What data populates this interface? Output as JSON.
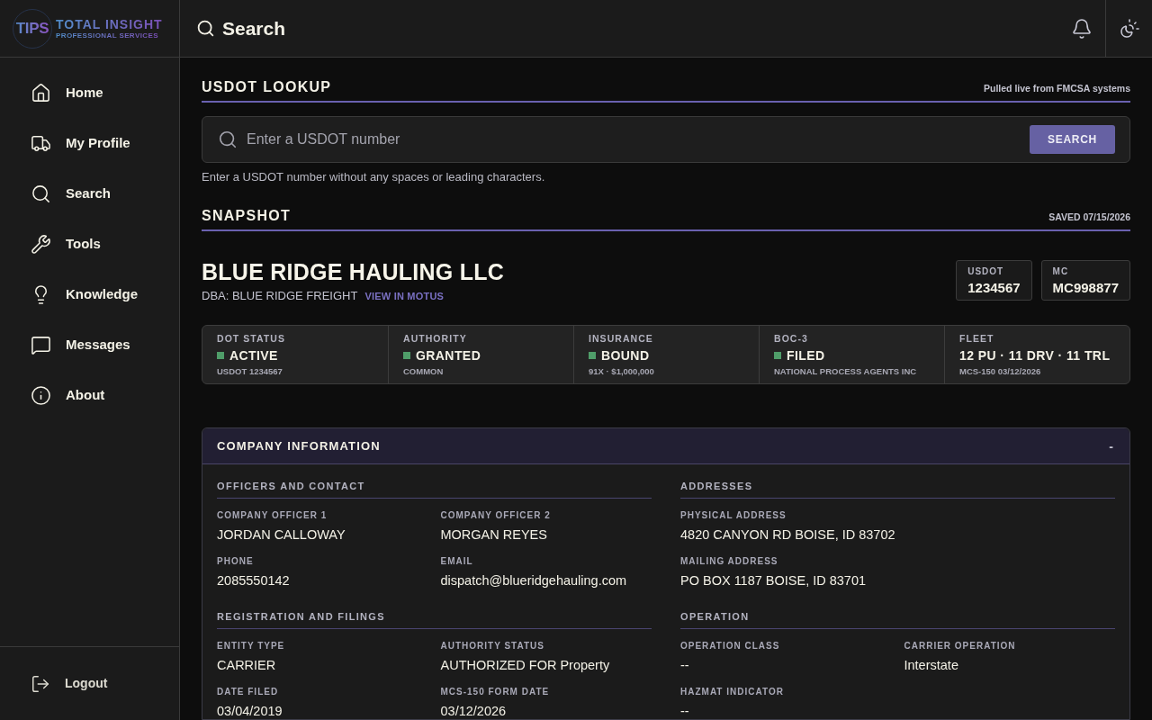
{
  "logo": {
    "mark": "TIPS",
    "title": "TOTAL INSIGHT",
    "subtitle": "PROFESSIONAL SERVICES"
  },
  "top_bar": {
    "search_label": "Search"
  },
  "sidebar": {
    "items": [
      {
        "label": "Home"
      },
      {
        "label": "My Profile"
      },
      {
        "label": "Search"
      },
      {
        "label": "Tools"
      },
      {
        "label": "Knowledge"
      },
      {
        "label": "Messages"
      },
      {
        "label": "About"
      }
    ],
    "logout": {
      "label": "Logout"
    }
  },
  "lookup": {
    "title": "USDOT LOOKUP",
    "note": "Pulled live from FMCSA systems",
    "placeholder": "Enter a USDOT number",
    "button": "SEARCH",
    "hint": "Enter a USDOT number without any spaces or leading characters."
  },
  "snapshot": {
    "title": "SNAPSHOT",
    "saved": "SAVED 07/15/2026",
    "company_name": "BLUE RIDGE HAULING LLC",
    "dba": "DBA: BLUE RIDGE FREIGHT",
    "link": "VIEW IN MOTUS",
    "ids": [
      {
        "label": "USDOT",
        "value": "1234567"
      },
      {
        "label": "MC",
        "value": "MC998877"
      }
    ],
    "statuses": [
      {
        "label": "DOT STATUS",
        "value": "ACTIVE",
        "detail": "USDOT 1234567",
        "color": "#4f9d69"
      },
      {
        "label": "AUTHORITY",
        "value": "GRANTED",
        "detail": "COMMON",
        "color": "#4f9d69"
      },
      {
        "label": "INSURANCE",
        "value": "BOUND",
        "detail": "91X · $1,000,000",
        "color": "#4f9d69"
      },
      {
        "label": "BOC-3",
        "value": "FILED",
        "detail": "NATIONAL PROCESS AGENTS INC",
        "color": "#4f9d69"
      },
      {
        "label": "FLEET",
        "value": "12 PU · 11 DRV · 11 TRL",
        "detail": "MCS-150 03/12/2026"
      }
    ]
  },
  "company_information": {
    "title": "COMPANY INFORMATION",
    "toggle": "-",
    "expanded": true,
    "sections": [
      {
        "title": "OFFICERS AND CONTACT",
        "kind": "grid",
        "fields": [
          {
            "label": "COMPANY OFFICER 1",
            "value": "JORDAN CALLOWAY"
          },
          {
            "label": "COMPANY OFFICER 2",
            "value": "MORGAN REYES"
          },
          {
            "label": "PHONE",
            "value": "2085550142"
          },
          {
            "label": "EMAIL",
            "value": "dispatch@blueridgehauling.com"
          }
        ]
      },
      {
        "title": "ADDRESSES",
        "kind": "stack",
        "fields": [
          {
            "label": "PHYSICAL ADDRESS",
            "value": "4820 CANYON RD BOISE, ID 83702"
          },
          {
            "label": "MAILING ADDRESS",
            "value": "PO BOX 1187 BOISE, ID 83701"
          }
        ]
      },
      {
        "title": "REGISTRATION AND FILINGS",
        "kind": "grid",
        "fields": [
          {
            "label": "ENTITY TYPE",
            "value": "CARRIER"
          },
          {
            "label": "AUTHORITY STATUS",
            "value": "AUTHORIZED FOR Property"
          },
          {
            "label": "DATE FILED",
            "value": "03/04/2019"
          },
          {
            "label": "MCS-150 FORM DATE",
            "value": "03/12/2026"
          }
        ]
      },
      {
        "title": "OPERATION",
        "kind": "grid",
        "fields": [
          {
            "label": "OPERATION CLASS",
            "value": "--"
          },
          {
            "label": "CARRIER OPERATION",
            "value": "Interstate"
          },
          {
            "label": "HAZMAT INDICATOR",
            "value": "--"
          }
        ]
      }
    ]
  }
}
